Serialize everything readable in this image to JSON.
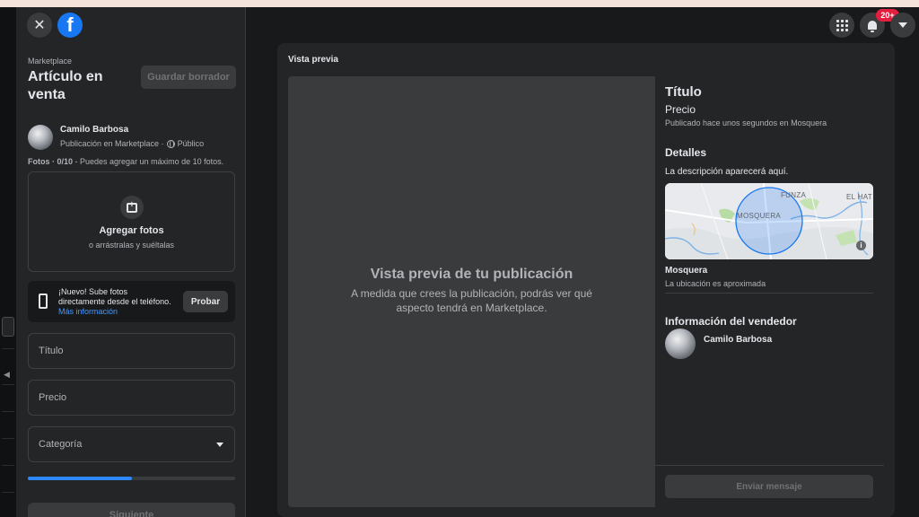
{
  "header": {
    "notification_badge": "20+"
  },
  "sidebar": {
    "breadcrumb": "Marketplace",
    "title": "Artículo en venta",
    "save_draft_label": "Guardar borrador",
    "user": {
      "name": "Camilo Barbosa",
      "context": "Publicación en Marketplace ·",
      "privacy": "Público"
    },
    "photos": {
      "count_label": "Fotos · 0/10",
      "limit_note": " - Puedes agregar un máximo de 10 fotos.",
      "add_label": "Agregar fotos",
      "drag_hint": "o arrástralas y suéltalas"
    },
    "promo": {
      "text": "¡Nuevo! Sube fotos directamente desde el teléfono.",
      "link": "Más información",
      "button": "Probar"
    },
    "fields": {
      "title_placeholder": "Título",
      "price_placeholder": "Precio",
      "category_placeholder": "Categoría"
    },
    "progress_fraction": 0.5,
    "next_label": "Siguiente"
  },
  "preview": {
    "label": "Vista previa",
    "heading": "Vista previa de tu publicación",
    "description": "A medida que crees la publicación, podrás ver qué aspecto tendrá en Marketplace.",
    "details": {
      "title": "Título",
      "price": "Precio",
      "posted": "Publicado hace unos segundos en Mosquera",
      "details_heading": "Detalles",
      "description": "La descripción aparecerá aquí.",
      "map_labels": {
        "funza": "FUNZA",
        "el_hato": "EL HAT",
        "mosquera": "MOSQUERA"
      },
      "location": "Mosquera",
      "location_note": "La ubicación es aproximada",
      "seller_heading": "Información del vendedor",
      "seller_name": "Camilo Barbosa",
      "message_button": "Enviar mensaje"
    }
  },
  "colors": {
    "background": "#18191a",
    "panel": "#242526",
    "accent": "#1877f2",
    "progress": "#2d88ff",
    "badge": "#e41e3f",
    "link": "#4599ff"
  },
  "icons": [
    "close-icon",
    "facebook-logo-icon",
    "globe-icon",
    "add-photo-icon",
    "phone-icon",
    "caret-down-icon",
    "apps-grid-icon",
    "bell-icon",
    "account-menu-icon",
    "map-info-icon"
  ]
}
